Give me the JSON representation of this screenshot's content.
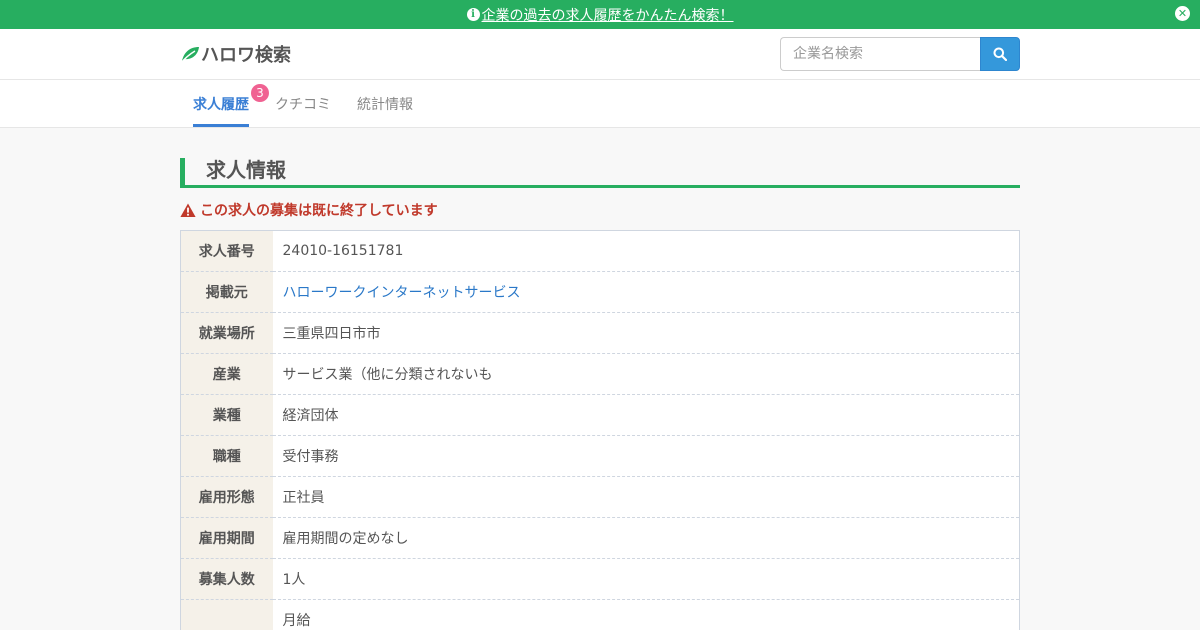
{
  "banner": {
    "text": "企業の過去の求人履歴をかんたん検索！"
  },
  "header": {
    "logo_text": "ハロワ検索",
    "search_placeholder": "企業名検索"
  },
  "tabs": [
    {
      "label": "求人履歴",
      "badge": "3"
    },
    {
      "label": "クチコミ"
    },
    {
      "label": "統計情報"
    }
  ],
  "main": {
    "section_title": "求人情報",
    "alert": "この求人の募集は既に終了しています",
    "rows": [
      {
        "label": "求人番号",
        "value": "24010-16151781"
      },
      {
        "label": "掲載元",
        "value": "ハローワークインターネットサービス"
      },
      {
        "label": "就業場所",
        "value": "三重県四日市市"
      },
      {
        "label": "産業",
        "value": "サービス業（他に分類されないも"
      },
      {
        "label": "業種",
        "value": "経済団体"
      },
      {
        "label": "職種",
        "value": "受付事務"
      },
      {
        "label": "雇用形態",
        "value": "正社員"
      },
      {
        "label": "雇用期間",
        "value": "雇用期間の定めなし"
      },
      {
        "label": "募集人数",
        "value": "1人"
      },
      {
        "label": "",
        "value": "月給"
      }
    ]
  },
  "colors": {
    "brand_green": "#27ae60",
    "accent_blue": "#3a7fd5",
    "alert_red": "#c0392b",
    "badge_pink": "#f06292"
  }
}
